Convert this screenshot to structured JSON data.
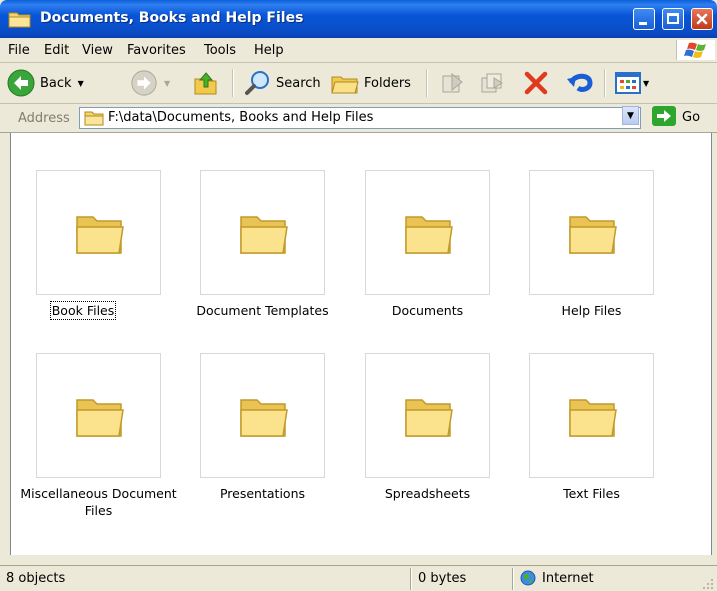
{
  "window": {
    "title": "Documents, Books and Help Files",
    "controls": {
      "minimize": "_",
      "maximize": "□",
      "close": "✕"
    }
  },
  "menu": [
    "File",
    "Edit",
    "View",
    "Favorites",
    "Tools",
    "Help"
  ],
  "toolbar": {
    "back_label": "Back",
    "search_label": "Search",
    "folders_label": "Folders"
  },
  "address": {
    "label": "Address",
    "value": "F:\\data\\Documents, Books and Help Files",
    "go_label": "Go"
  },
  "folders": [
    {
      "name": "Book Files",
      "selected": true
    },
    {
      "name": "Document Templates"
    },
    {
      "name": "Documents"
    },
    {
      "name": "Help Files"
    },
    {
      "name": "Miscellaneous Document Files"
    },
    {
      "name": "Presentations"
    },
    {
      "name": "Spreadsheets"
    },
    {
      "name": "Text Files"
    }
  ],
  "status": {
    "objects": "8 objects",
    "size": "0 bytes",
    "zone": "Internet"
  },
  "colors": {
    "titlebar": "#0a4bc4",
    "close_button": "#c0391c",
    "go_button": "#2ea62e",
    "folder": "#f2d26a"
  }
}
